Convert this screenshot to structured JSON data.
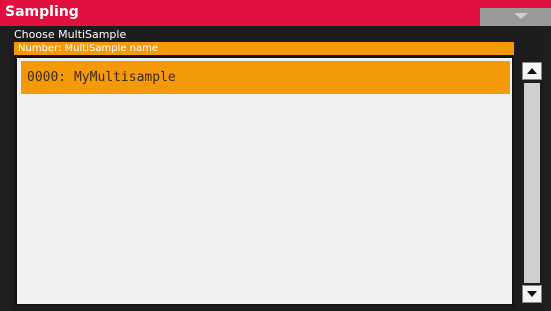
{
  "window": {
    "title": "Sampling"
  },
  "dialog": {
    "title": "Choose MultiSample",
    "column_header": "Number: MultiSample name",
    "items": [
      {
        "label": "0000: MyMultisample",
        "selected": true
      }
    ]
  },
  "colors": {
    "title_bar": "#e0103f",
    "highlight": "#f49a08",
    "list_background": "#f1f1f1",
    "background": "#1e1e1e"
  },
  "icons": {
    "menu": "chevron-down-icon",
    "scroll_up": "arrow-up-icon",
    "scroll_down": "arrow-down-icon"
  }
}
